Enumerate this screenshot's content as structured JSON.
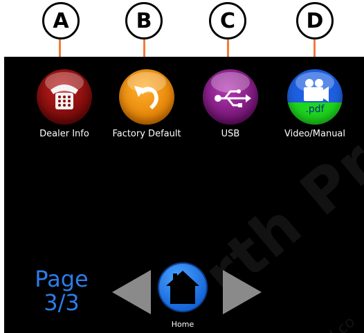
{
  "callouts": [
    "A",
    "B",
    "C",
    "D"
  ],
  "apps": [
    {
      "label": "Dealer Info",
      "icon": "telephone-icon",
      "color": "#8b0a0a"
    },
    {
      "label": "Factory Default",
      "icon": "undo-arrow-icon",
      "color": "#f39000"
    },
    {
      "label": "USB",
      "icon": "usb-icon",
      "color": "#8c1a8c"
    },
    {
      "label": "Video/Manual",
      "icon": "video-camera-icon",
      "color": "#1d5fe0",
      "badge": ".pdf",
      "badge_color": "#1ed61e"
    }
  ],
  "pagination": {
    "label": "Page",
    "value": "3/3",
    "color": "#2b7de9"
  },
  "nav": {
    "home_label": "Home",
    "left_icon": "left-arrow-icon",
    "right_icon": "right-arrow-icon"
  },
  "watermark": {
    "text": "rth Pr",
    "small": "l.co"
  },
  "colors": {
    "leader": "#f07c3a",
    "screen_bg": "#000000",
    "home_button": "#1e73e6",
    "arrow": "#8a8a8a"
  }
}
